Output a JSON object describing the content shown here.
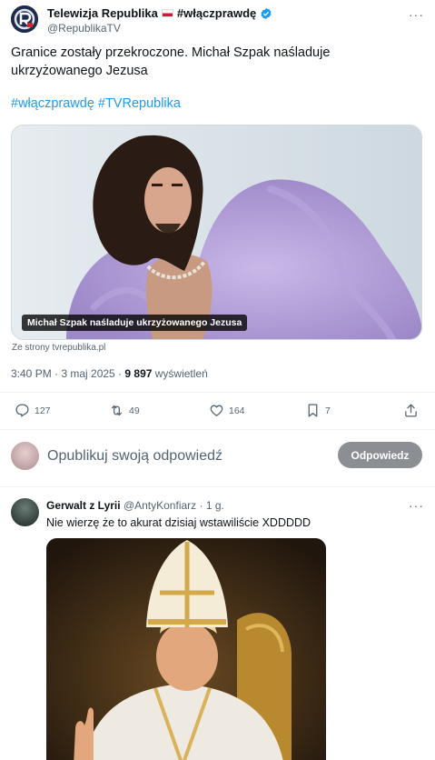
{
  "post": {
    "author_name": "Telewizja Republika",
    "author_tag": "#włączprawdę",
    "author_handle": "@RepublikaTV",
    "text": "Granice zostały przekroczone. Michał Szpak naśladuje ukrzyżowanego Jezusa",
    "hashtags": [
      "#włączprawdę",
      "#TVRepublika"
    ],
    "card_caption": "Michał Szpak naśladuje ukrzyżowanego Jezusa",
    "source": "Ze strony tvrepublika.pl",
    "time": "3:40 PM · 3 maj 2025 · ",
    "views_count": "9 897",
    "views_label": " wyświetleń",
    "more": "···"
  },
  "actions": {
    "replies": "127",
    "reposts": "49",
    "likes": "164",
    "bookmarks": "7"
  },
  "reply_box": {
    "placeholder": "Opublikuj swoją odpowiedź",
    "button": "Odpowiedz"
  },
  "comment": {
    "name": "Gerwalt z Lyrii",
    "handle": "@AntyKonfiarz",
    "time": " · 1 g.",
    "text": "Nie wierzę że to akurat dzisiaj wstawiliście XDDDDD",
    "more": "···"
  },
  "colors": {
    "accent": "#1d9bf0",
    "muted": "#536471",
    "button_bg": "#8b8f93"
  },
  "icons": [
    "republika-logo-icon",
    "verified-badge-icon",
    "more-icon",
    "reply-icon",
    "repost-icon",
    "like-icon",
    "bookmark-icon",
    "share-icon"
  ]
}
